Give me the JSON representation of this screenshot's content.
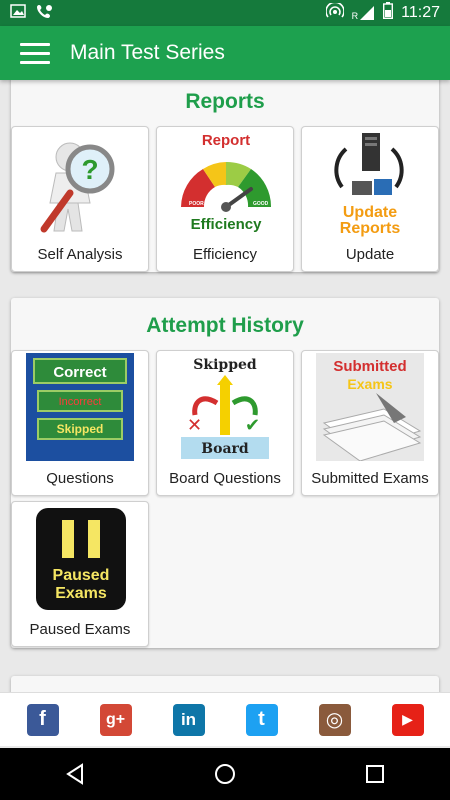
{
  "status_bar": {
    "time": "11:27",
    "signal_label": "R",
    "icons": [
      "image-icon",
      "phone-voicemail-icon",
      "hotspot-icon",
      "signal-icon",
      "battery-icon"
    ]
  },
  "app_bar": {
    "title": "Main Test Series",
    "menu_icon": "hamburger-icon"
  },
  "reports": {
    "title": "Reports",
    "tiles": [
      {
        "label": "Self Analysis",
        "icon": "magnifier-question-icon"
      },
      {
        "label": "Efficiency",
        "icon": "report-gauge-icon",
        "image_text": {
          "top": "Report",
          "bottom": "Efficiency",
          "poor": "POOR",
          "good": "GOOD"
        }
      },
      {
        "label": "Update",
        "icon": "update-reports-icon",
        "image_text": {
          "line1": "Update",
          "line2": "Reports"
        }
      }
    ]
  },
  "attempt_history": {
    "title": "Attempt History",
    "tiles": [
      {
        "label": "Questions",
        "icon": "correct-incorrect-skipped-icon",
        "image_text": {
          "a": "Correct",
          "b": "Incorrect",
          "c": "Skipped"
        }
      },
      {
        "label": "Board Questions",
        "icon": "skipped-board-icon",
        "image_text": {
          "top": "Skipped",
          "bottom": "Board"
        }
      },
      {
        "label": "Submitted Exams",
        "icon": "submitted-exams-icon",
        "image_text": {
          "line1": "Submitted",
          "line2": "Exams"
        }
      },
      {
        "label": "Paused Exams",
        "icon": "pause-icon",
        "image_text": {
          "line1": "Paused",
          "line2": "Exams"
        }
      }
    ]
  },
  "social": [
    {
      "name": "facebook",
      "glyph": "f",
      "color": "#3b5998"
    },
    {
      "name": "google-plus",
      "glyph": "g+",
      "color": "#d34836"
    },
    {
      "name": "linkedin",
      "glyph": "in",
      "color": "#0e76a8"
    },
    {
      "name": "twitter",
      "glyph": "t",
      "color": "#1da1f2"
    },
    {
      "name": "instagram",
      "glyph": "◎",
      "color": "#8a5a3c"
    },
    {
      "name": "youtube",
      "glyph": "▶",
      "color": "#e62117"
    }
  ],
  "colors": {
    "status_bar": "#157a3c",
    "app_bar": "#1da14f",
    "section_title": "#1f9e4b"
  }
}
